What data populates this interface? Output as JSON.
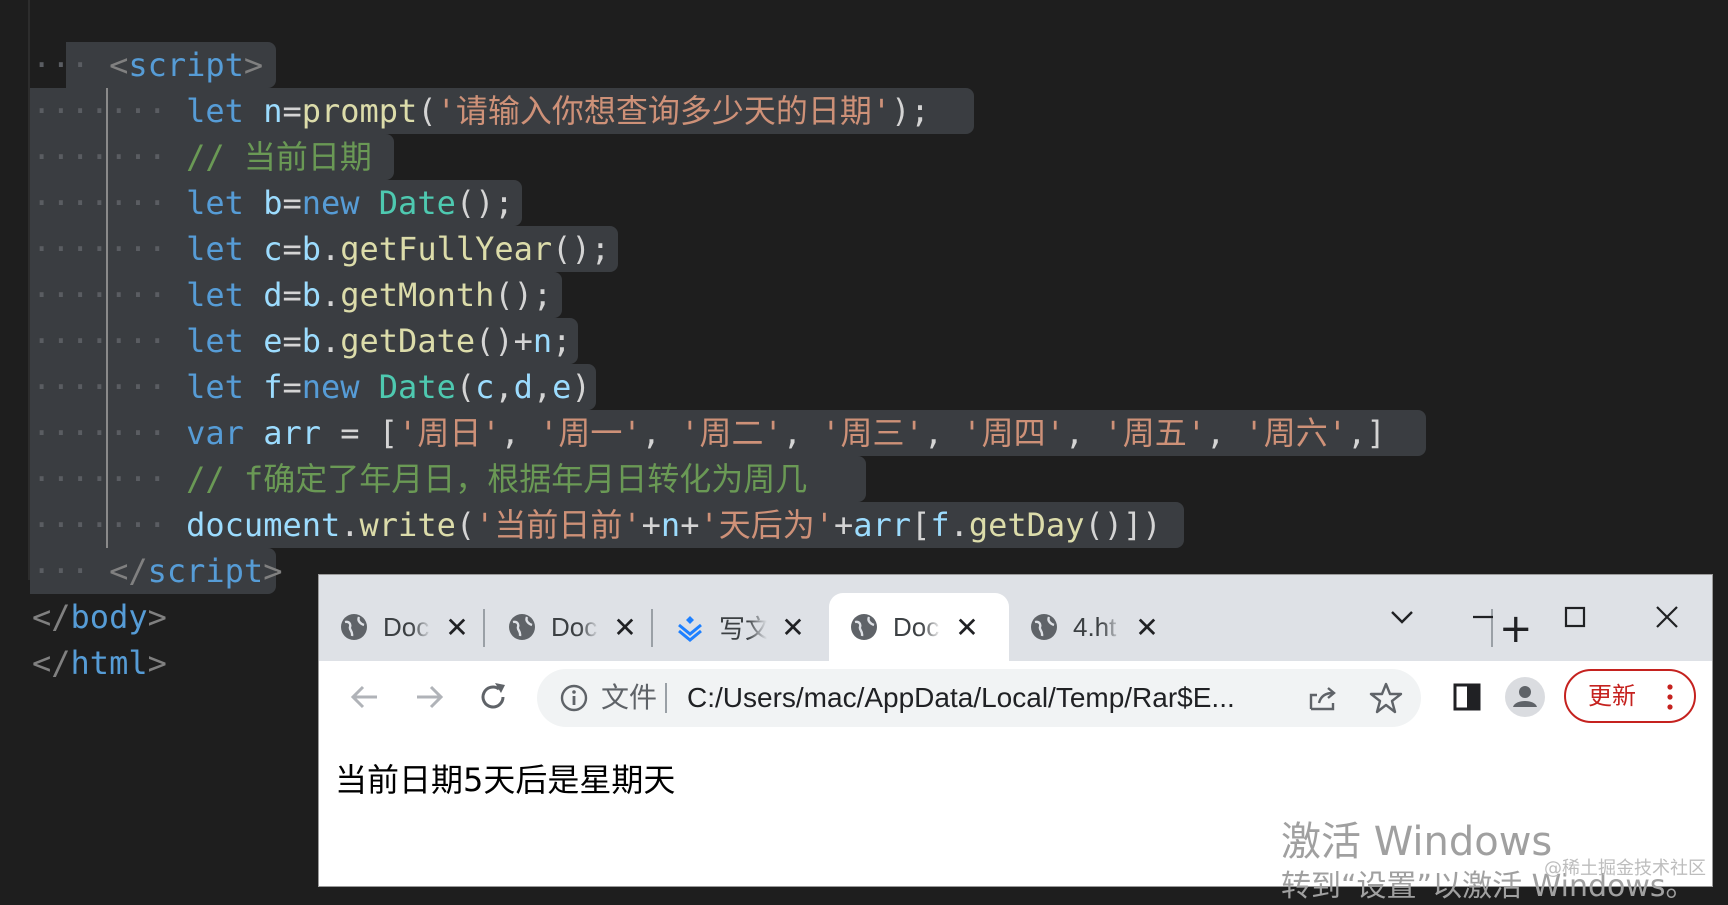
{
  "editor": {
    "lines": [
      {
        "tokens": [
          {
            "c": "t-pun",
            "t": "<"
          },
          {
            "c": "t-tag",
            "t": "script"
          },
          {
            "c": "t-pun",
            "t": ">"
          }
        ]
      },
      {
        "tokens": [
          {
            "c": "t-kw",
            "t": "let "
          },
          {
            "c": "t-var",
            "t": "n"
          },
          {
            "c": "t-op",
            "t": "="
          },
          {
            "c": "t-fn",
            "t": "prompt"
          },
          {
            "c": "t-op",
            "t": "("
          },
          {
            "c": "t-str",
            "t": "'请输入你想查询多少天的日期'"
          },
          {
            "c": "t-op",
            "t": ");"
          }
        ]
      },
      {
        "tokens": [
          {
            "c": "t-com",
            "t": "// 当前日期"
          }
        ]
      },
      {
        "tokens": [
          {
            "c": "t-kw",
            "t": "let "
          },
          {
            "c": "t-var",
            "t": "b"
          },
          {
            "c": "t-op",
            "t": "="
          },
          {
            "c": "t-kw",
            "t": "new "
          },
          {
            "c": "t-cls",
            "t": "Date"
          },
          {
            "c": "t-op",
            "t": "();"
          }
        ]
      },
      {
        "tokens": [
          {
            "c": "t-kw",
            "t": "let "
          },
          {
            "c": "t-var",
            "t": "c"
          },
          {
            "c": "t-op",
            "t": "="
          },
          {
            "c": "t-var",
            "t": "b"
          },
          {
            "c": "t-op",
            "t": "."
          },
          {
            "c": "t-fn",
            "t": "getFullYear"
          },
          {
            "c": "t-op",
            "t": "();"
          }
        ]
      },
      {
        "tokens": [
          {
            "c": "t-kw",
            "t": "let "
          },
          {
            "c": "t-var",
            "t": "d"
          },
          {
            "c": "t-op",
            "t": "="
          },
          {
            "c": "t-var",
            "t": "b"
          },
          {
            "c": "t-op",
            "t": "."
          },
          {
            "c": "t-fn",
            "t": "getMonth"
          },
          {
            "c": "t-op",
            "t": "();"
          }
        ]
      },
      {
        "tokens": [
          {
            "c": "t-kw",
            "t": "let "
          },
          {
            "c": "t-var",
            "t": "e"
          },
          {
            "c": "t-op",
            "t": "="
          },
          {
            "c": "t-var",
            "t": "b"
          },
          {
            "c": "t-op",
            "t": "."
          },
          {
            "c": "t-fn",
            "t": "getDate"
          },
          {
            "c": "t-op",
            "t": "()+"
          },
          {
            "c": "t-var",
            "t": "n"
          },
          {
            "c": "t-op",
            "t": ";"
          }
        ]
      },
      {
        "tokens": [
          {
            "c": "t-kw",
            "t": "let "
          },
          {
            "c": "t-var",
            "t": "f"
          },
          {
            "c": "t-op",
            "t": "="
          },
          {
            "c": "t-kw",
            "t": "new "
          },
          {
            "c": "t-cls",
            "t": "Date"
          },
          {
            "c": "t-op",
            "t": "("
          },
          {
            "c": "t-var",
            "t": "c"
          },
          {
            "c": "t-op",
            "t": ","
          },
          {
            "c": "t-var",
            "t": "d"
          },
          {
            "c": "t-op",
            "t": ","
          },
          {
            "c": "t-var",
            "t": "e"
          },
          {
            "c": "t-op",
            "t": ")"
          }
        ]
      },
      {
        "tokens": [
          {
            "c": "t-kw",
            "t": "var "
          },
          {
            "c": "t-var",
            "t": "arr"
          },
          {
            "c": "t-op",
            "t": " = ["
          },
          {
            "c": "t-str",
            "t": "'周日'"
          },
          {
            "c": "t-op",
            "t": ", "
          },
          {
            "c": "t-str",
            "t": "'周一'"
          },
          {
            "c": "t-op",
            "t": ", "
          },
          {
            "c": "t-str",
            "t": "'周二'"
          },
          {
            "c": "t-op",
            "t": ", "
          },
          {
            "c": "t-str",
            "t": "'周三'"
          },
          {
            "c": "t-op",
            "t": ", "
          },
          {
            "c": "t-str",
            "t": "'周四'"
          },
          {
            "c": "t-op",
            "t": ", "
          },
          {
            "c": "t-str",
            "t": "'周五'"
          },
          {
            "c": "t-op",
            "t": ", "
          },
          {
            "c": "t-str",
            "t": "'周六'"
          },
          {
            "c": "t-op",
            "t": ",]"
          }
        ]
      },
      {
        "tokens": [
          {
            "c": "t-com",
            "t": "// f确定了年月日，根据年月日转化为周几"
          }
        ]
      },
      {
        "tokens": [
          {
            "c": "t-var",
            "t": "document"
          },
          {
            "c": "t-op",
            "t": "."
          },
          {
            "c": "t-fn",
            "t": "write"
          },
          {
            "c": "t-op",
            "t": "("
          },
          {
            "c": "t-str",
            "t": "'当前日前'"
          },
          {
            "c": "t-op",
            "t": "+"
          },
          {
            "c": "t-var",
            "t": "n"
          },
          {
            "c": "t-op",
            "t": "+"
          },
          {
            "c": "t-str",
            "t": "'天后为'"
          },
          {
            "c": "t-op",
            "t": "+"
          },
          {
            "c": "t-var",
            "t": "arr"
          },
          {
            "c": "t-op",
            "t": "["
          },
          {
            "c": "t-var",
            "t": "f"
          },
          {
            "c": "t-op",
            "t": "."
          },
          {
            "c": "t-fn",
            "t": "getDay"
          },
          {
            "c": "t-op",
            "t": "()])"
          }
        ]
      },
      {
        "tokens": [
          {
            "c": "t-pun",
            "t": "</"
          },
          {
            "c": "t-tag",
            "t": "script"
          },
          {
            "c": "t-pun",
            "t": ">"
          }
        ]
      },
      {
        "tokens": [
          {
            "c": "t-pun",
            "t": "</"
          },
          {
            "c": "t-tag",
            "t": "body"
          },
          {
            "c": "t-pun",
            "t": ">"
          }
        ]
      },
      {
        "tokens": [
          {
            "c": "t-pun",
            "t": "</"
          },
          {
            "c": "t-tag",
            "t": "html"
          },
          {
            "c": "t-pun",
            "t": ">"
          }
        ]
      }
    ]
  },
  "browser": {
    "tabs": [
      {
        "title": "Doc",
        "icon": "globe-icon"
      },
      {
        "title": "Doc",
        "icon": "globe-icon"
      },
      {
        "title": "写文",
        "icon": "juejin-icon"
      },
      {
        "title": "Doc",
        "icon": "globe-icon"
      },
      {
        "title": "4.ht",
        "icon": "globe-icon"
      }
    ],
    "tab_close": "✕",
    "new_tab": "+",
    "omnibox": {
      "scheme_label": "文件",
      "url": "C:/Users/mac/AppData/Local/Temp/Rar$E..."
    },
    "update_label": "更新",
    "page_text": "当前日期5天后是星期天",
    "watermark_title": "激活 Windows",
    "watermark_sub": "转到“设置”以激活 Windows。",
    "credit": "@稀土掘金技术社区"
  },
  "colors": {
    "accent_red": "#c5221f",
    "editor_bg": "#1e1e1e",
    "selection": "#3a3d41"
  }
}
